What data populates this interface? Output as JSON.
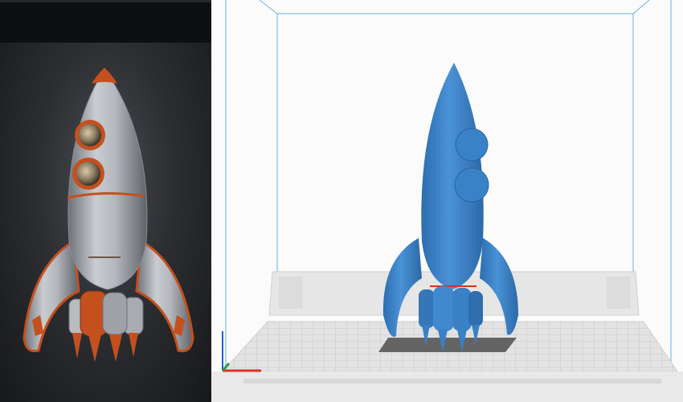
{
  "photo": {
    "subject": "retro-rocket-photo",
    "colors": {
      "background": "#202226",
      "body": "#a9aeb4",
      "trim": "#c4501e"
    }
  },
  "arrow": {
    "color": "#d8321e"
  },
  "viewport": {
    "model": "rocket-3d-model",
    "colors": {
      "model": "#3f86cc",
      "model_shade": "#2d6db0",
      "build_volume_edge": "#66b2e8",
      "plate": "#dfdfdf",
      "grid": "#c6c6c6",
      "shadow": "#555555",
      "axis_x": "#e0302a",
      "axis_y": "#2f9a3a",
      "axis_z": "#2a5ad8"
    }
  }
}
